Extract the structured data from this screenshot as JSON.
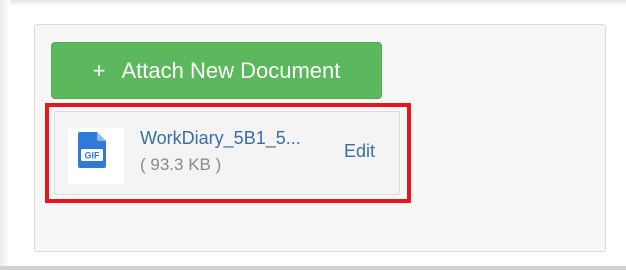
{
  "attachments": {
    "attach_button_label": "Attach New Document",
    "attach_button_icon": "+",
    "document": {
      "file_type": "GIF",
      "file_name": "WorkDiary_5B1_5...",
      "file_size": "( 93.3 KB )",
      "edit_label": "Edit"
    }
  },
  "colors": {
    "button_green": "#5cb85c",
    "highlight_red": "#e8161e",
    "link_blue": "#3a6ea8",
    "file_icon_blue": "#2f7ad8"
  }
}
